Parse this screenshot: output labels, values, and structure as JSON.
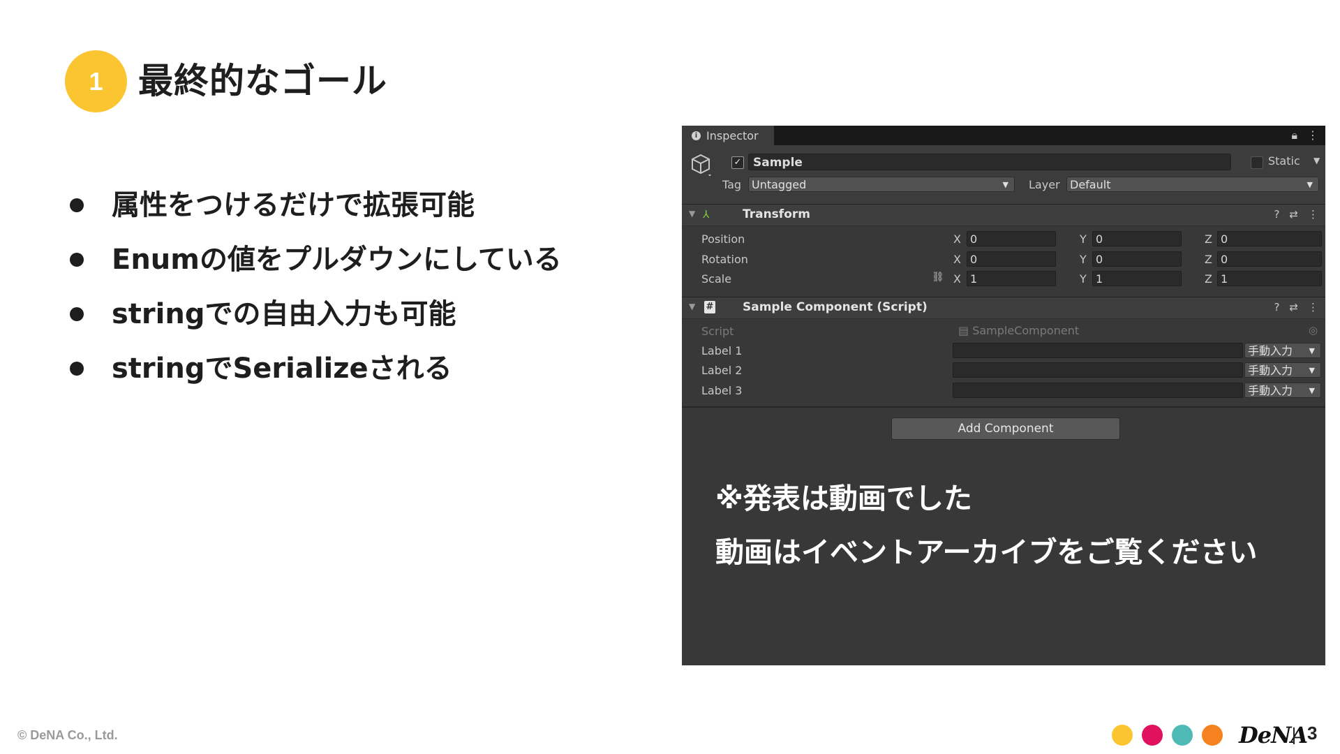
{
  "slide": {
    "number": "1",
    "title": "最終的なゴール",
    "bullets": [
      "属性をつけるだけで拡張可能",
      "Enumの値をプルダウンにしている",
      "stringでの自由入力も可能",
      "stringでSerializeされる"
    ],
    "footer_copyright": "© DeNA Co., Ltd.",
    "brand": "DeNA",
    "page_number": "3",
    "brand_dot_colors": [
      "#fbc531",
      "#e0115f",
      "#4fbab5",
      "#f5821f"
    ]
  },
  "inspector": {
    "tab_label": "Inspector",
    "object_name": "Sample",
    "static_label": "Static",
    "tag_label": "Tag",
    "tag_value": "Untagged",
    "layer_label": "Layer",
    "layer_value": "Default",
    "transform": {
      "title": "Transform",
      "rows": [
        {
          "label": "Position",
          "x": "0",
          "y": "0",
          "z": "0"
        },
        {
          "label": "Rotation",
          "x": "0",
          "y": "0",
          "z": "0"
        },
        {
          "label": "Scale",
          "x": "1",
          "y": "1",
          "z": "1"
        }
      ],
      "axis_labels": [
        "X",
        "Y",
        "Z"
      ]
    },
    "sample_component": {
      "title": "Sample Component (Script)",
      "script_label": "Script",
      "script_value": "SampleComponent",
      "labels": [
        {
          "label": "Label 1",
          "mode": "手動入力"
        },
        {
          "label": "Label 2",
          "mode": "手動入力"
        },
        {
          "label": "Label 3",
          "mode": "手動入力"
        }
      ]
    },
    "add_component_label": "Add Component",
    "overlay_line1": "※発表は動画でした",
    "overlay_line2": "動画はイベントアーカイブをご覧ください"
  }
}
